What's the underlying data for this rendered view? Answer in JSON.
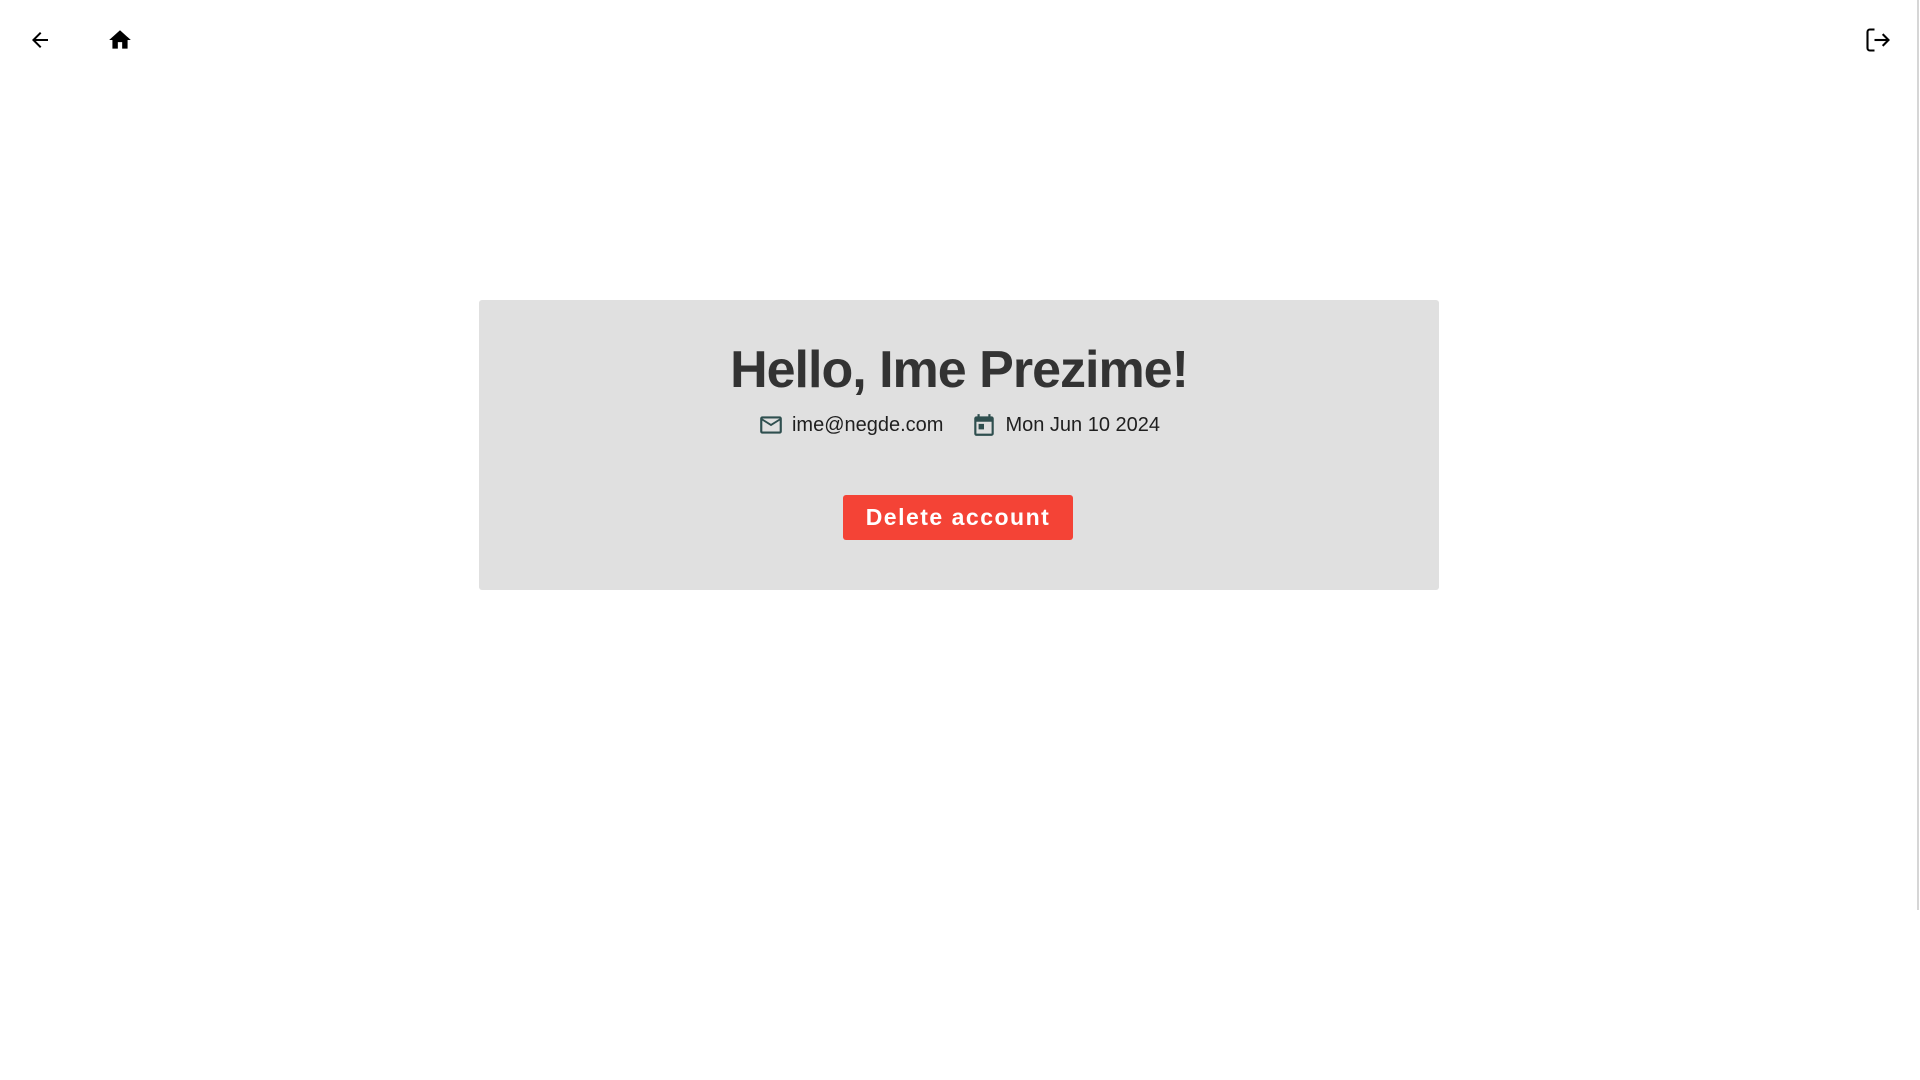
{
  "topbar": {
    "back_icon": "arrow-left-icon",
    "home_icon": "home-icon",
    "logout_icon": "logout-icon"
  },
  "profile": {
    "greeting": "Hello, Ime Prezime!",
    "email": "ime@negde.com",
    "email_icon": "mail-icon",
    "joined_date": "Mon Jun 10 2024",
    "date_icon": "calendar-icon",
    "delete_label": "Delete account"
  },
  "colors": {
    "card_background": "#e0e0e0",
    "danger": "#f44336",
    "heading": "#333333",
    "icon_teal": "#2f4f4f"
  }
}
